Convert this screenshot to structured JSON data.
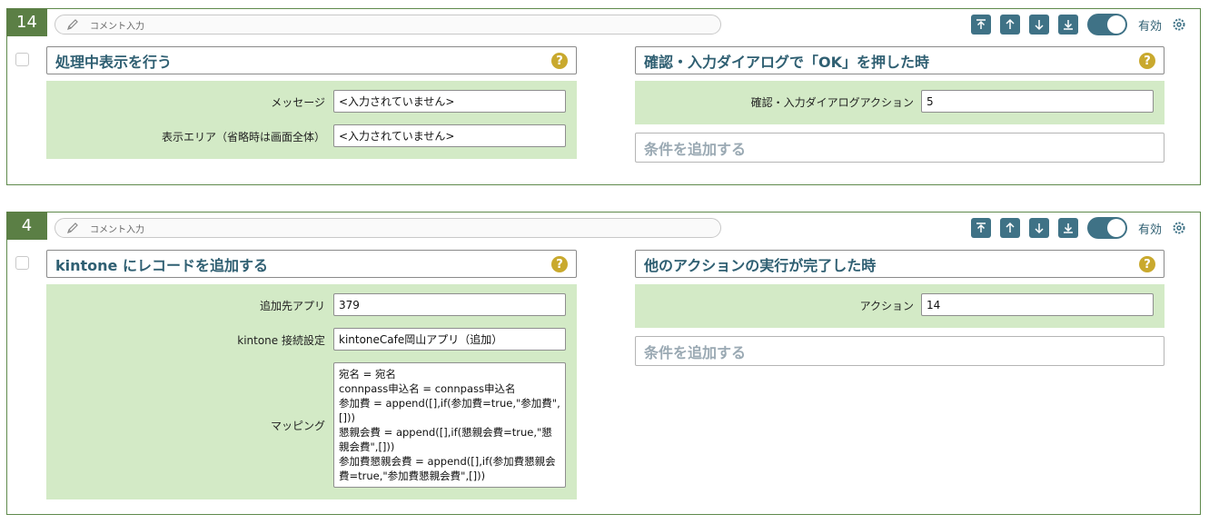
{
  "enabled_label": "有効",
  "comment_placeholder": "コメント入力",
  "help_glyph": "?",
  "cards": [
    {
      "number": "14",
      "left_title": "処理中表示を行う",
      "left_fields": [
        {
          "label": "メッセージ",
          "value": "<入力されていません>"
        },
        {
          "label": "表示エリア（省略時は画面全体）",
          "value": "<入力されていません>"
        }
      ],
      "right_title": "確認・入力ダイアログで「OK」を押した時",
      "right_fields": [
        {
          "label": "確認・入力ダイアログアクション",
          "value": "5"
        }
      ],
      "add_condition": "条件を追加する"
    },
    {
      "number": "4",
      "left_title": "kintone にレコードを追加する",
      "left_fields": [
        {
          "label": "追加先アプリ",
          "value": "379"
        },
        {
          "label": "kintone 接続設定",
          "value": "kintoneCafe岡山アプリ（追加）"
        },
        {
          "label": "マッピング",
          "value": "宛名 = 宛名\nconnpass申込名 = connpass申込名\n参加費 = append([],if(参加費=true,\"参加費\",[]))\n懇親会費 = append([],if(懇親会費=true,\"懇親会費\",[]))\n参加費懇親会費 = append([],if(参加費懇親会費=true,\"参加費懇親会費\",[]))"
        }
      ],
      "right_title": "他のアクションの実行が完了した時",
      "right_fields": [
        {
          "label": "アクション",
          "value": "14"
        }
      ],
      "add_condition": "条件を追加する"
    }
  ]
}
